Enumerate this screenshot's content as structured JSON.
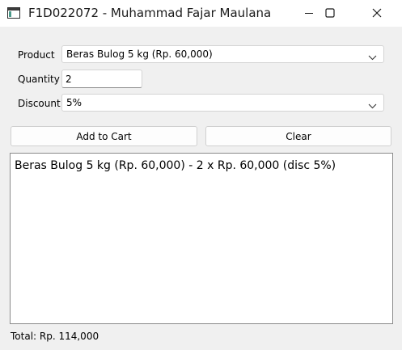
{
  "window": {
    "title": "F1D022072 - Muhammad Fajar Maulana"
  },
  "form": {
    "product": {
      "label": "Product",
      "value": "Beras Bulog 5 kg (Rp. 60,000)"
    },
    "quantity": {
      "label": "Quantity",
      "value": "2"
    },
    "discount": {
      "label": "Discount",
      "value": "5%"
    }
  },
  "buttons": {
    "add_to_cart": "Add to Cart",
    "clear": "Clear"
  },
  "cart": {
    "lines": [
      "Beras Bulog 5 kg (Rp. 60,000) - 2 x Rp. 60,000 (disc 5%)"
    ]
  },
  "footer": {
    "total": "Total: Rp. 114,000"
  },
  "icons": {
    "app": "app-window-icon",
    "minimize": "minimize-icon",
    "maximize": "maximize-icon",
    "close": "close-icon",
    "dropdown": "chevron-down-icon"
  },
  "colors": {
    "window_background": "#f0f0f0",
    "title_bar": "#ffffff",
    "field_background": "#ffffff",
    "field_border": "#d4d4d4"
  }
}
